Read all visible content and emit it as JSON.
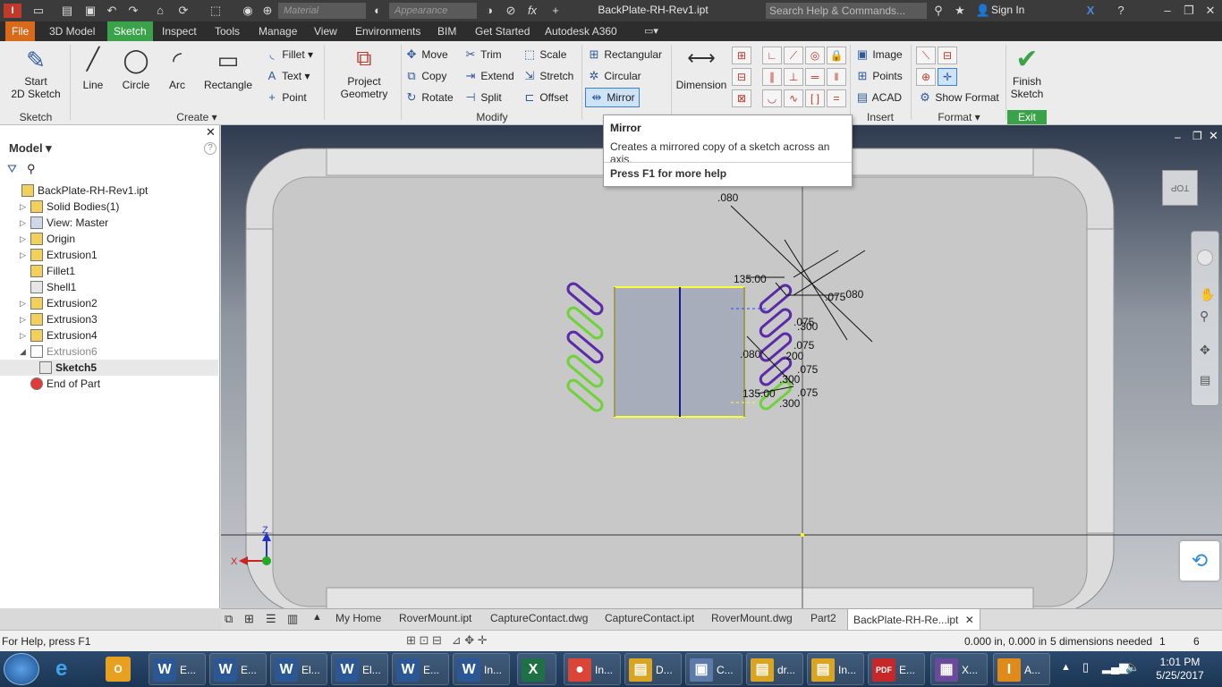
{
  "titlebar": {
    "material": "Material",
    "appearance": "Appearance",
    "document_title": "BackPlate-RH-Rev1.ipt",
    "search_placeholder": "Search Help & Commands...",
    "sign_in": "Sign In",
    "fx": "fx"
  },
  "tabs": [
    "File",
    "3D Model",
    "Sketch",
    "Inspect",
    "Tools",
    "Manage",
    "View",
    "Environments",
    "BIM",
    "Get Started",
    "Autodesk A360"
  ],
  "ribbon": {
    "start_sketch": "Start\n2D Sketch",
    "sketch_group": "Sketch",
    "line": "Line",
    "circle": "Circle",
    "arc": "Arc",
    "rectangle": "Rectangle",
    "fillet": "Fillet",
    "text": "Text",
    "point": "Point",
    "create_group": "Create",
    "project_geometry": "Project\nGeometry",
    "move": "Move",
    "copy": "Copy",
    "rotate": "Rotate",
    "trim": "Trim",
    "extend": "Extend",
    "split": "Split",
    "scale": "Scale",
    "stretch": "Stretch",
    "offset": "Offset",
    "modify_group": "Modify",
    "rectangular": "Rectangular",
    "circular": "Circular",
    "mirror": "Mirror",
    "dimension": "Dimension",
    "image": "Image",
    "points": "Points",
    "acad": "ACAD",
    "insert_group": "Insert",
    "show_format": "Show Format",
    "format_group": "Format",
    "finish_sketch": "Finish\nSketch",
    "exit_group": "Exit"
  },
  "tooltip": {
    "title": "Mirror",
    "description": "Creates a mirrored copy of a sketch across an axis.",
    "help": "Press F1 for more help"
  },
  "browser": {
    "title": "Model",
    "items": [
      {
        "label": "BackPlate-RH-Rev1.ipt",
        "expandable": false,
        "indent": 0
      },
      {
        "label": "Solid Bodies(1)",
        "expandable": true,
        "indent": 1
      },
      {
        "label": "View: Master",
        "expandable": true,
        "indent": 1
      },
      {
        "label": "Origin",
        "expandable": true,
        "indent": 1
      },
      {
        "label": "Extrusion1",
        "expandable": true,
        "indent": 1
      },
      {
        "label": "Fillet1",
        "expandable": false,
        "indent": 1
      },
      {
        "label": "Shell1",
        "expandable": false,
        "indent": 1
      },
      {
        "label": "Extrusion2",
        "expandable": true,
        "indent": 1
      },
      {
        "label": "Extrusion3",
        "expandable": true,
        "indent": 1
      },
      {
        "label": "Extrusion4",
        "expandable": true,
        "indent": 1
      },
      {
        "label": "Extrusion6",
        "expandable": true,
        "indent": 1
      },
      {
        "label": "Sketch5",
        "expandable": false,
        "indent": 2
      },
      {
        "label": "End of Part",
        "expandable": false,
        "indent": 1
      }
    ]
  },
  "canvas": {
    "viewcube_label": "TOP",
    "dims": [
      ".080",
      "135.00",
      ".075",
      ".080",
      ".075",
      ".300",
      ".075",
      ".200",
      ".080",
      ".075",
      ".300",
      "135.00",
      ".075",
      ".300"
    ]
  },
  "doc_tabs": [
    "My Home",
    "RoverMount.ipt",
    "CaptureContact.dwg",
    "CaptureContact.ipt",
    "RoverMount.dwg",
    "Part2",
    "BackPlate-RH-Re...ipt"
  ],
  "status": {
    "help": "For Help, press F1",
    "coords": "0.000 in, 0.000 in",
    "dims_needed": "5 dimensions needed",
    "count1": "1",
    "count2": "6"
  },
  "taskbar": {
    "items": [
      {
        "icon": "W",
        "label": "E...",
        "color": "#2b5797"
      },
      {
        "icon": "W",
        "label": "E...",
        "color": "#2b5797"
      },
      {
        "icon": "W",
        "label": "El...",
        "color": "#2b5797"
      },
      {
        "icon": "W",
        "label": "El...",
        "color": "#2b5797"
      },
      {
        "icon": "W",
        "label": "E...",
        "color": "#2b5797"
      },
      {
        "icon": "W",
        "label": "In...",
        "color": "#2b5797"
      },
      {
        "icon": "X",
        "label": "",
        "color": "#1e7145"
      },
      {
        "icon": "●",
        "label": "In...",
        "color": "#db4437"
      },
      {
        "icon": "▤",
        "label": "D...",
        "color": "#d9a520"
      },
      {
        "icon": "▣",
        "label": "C...",
        "color": "#5d7aa8"
      },
      {
        "icon": "▤",
        "label": "dr...",
        "color": "#d9a520"
      },
      {
        "icon": "▤",
        "label": "In...",
        "color": "#d9a520"
      },
      {
        "icon": "PDF",
        "label": "E...",
        "color": "#c62828"
      },
      {
        "icon": "▦",
        "label": "X...",
        "color": "#6a4a9a"
      },
      {
        "icon": "I",
        "label": "A...",
        "color": "#e08a1a"
      }
    ],
    "time": "1:01 PM",
    "date": "5/25/2017"
  }
}
